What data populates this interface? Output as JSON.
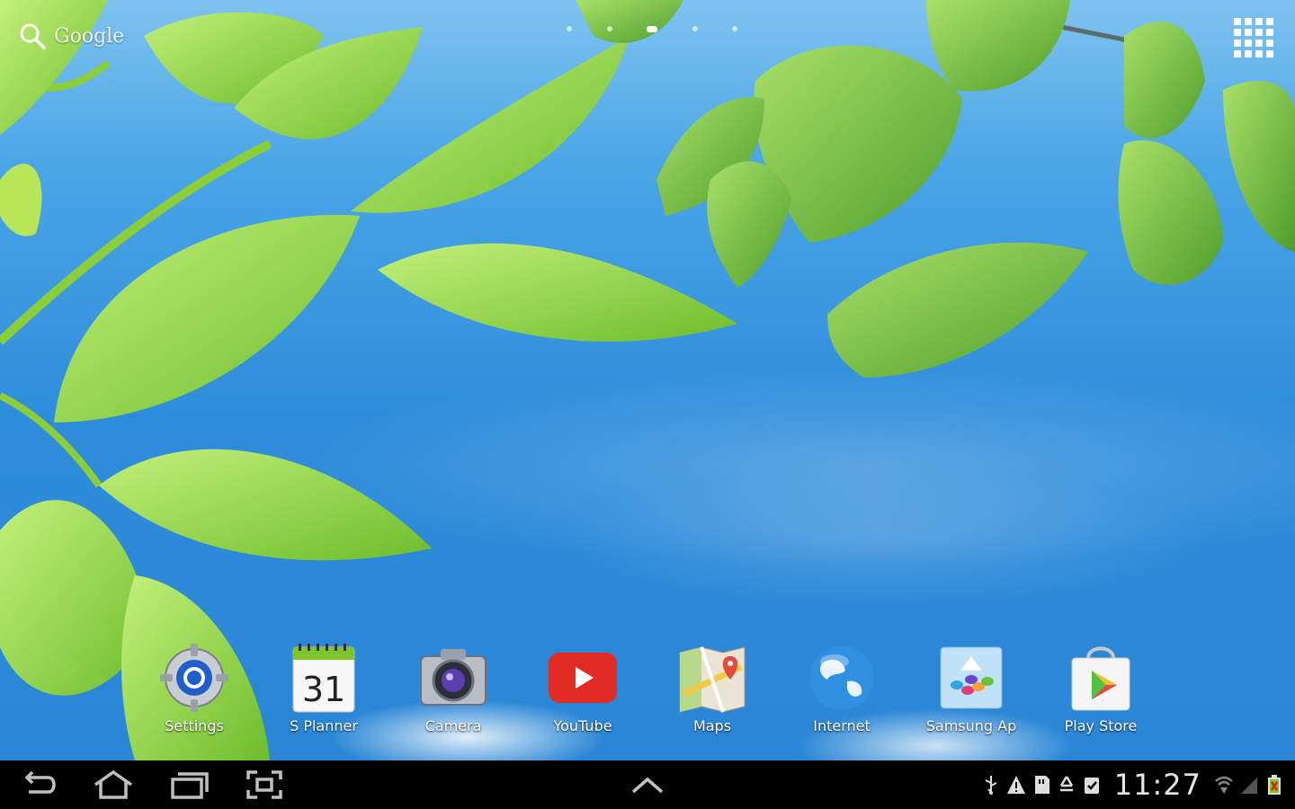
{
  "search": {
    "label": "Google",
    "icon": "search-icon"
  },
  "home_pages": {
    "count": 5,
    "active_index": 2
  },
  "apps_button": {
    "icon": "apps-grid-icon"
  },
  "dock": {
    "apps": [
      {
        "label": "Settings",
        "icon": "settings-icon"
      },
      {
        "label": "S Planner",
        "icon": "calendar-icon",
        "day": "31"
      },
      {
        "label": "Camera",
        "icon": "camera-icon"
      },
      {
        "label": "YouTube",
        "icon": "youtube-icon"
      },
      {
        "label": "Maps",
        "icon": "maps-icon"
      },
      {
        "label": "Internet",
        "icon": "globe-icon"
      },
      {
        "label": "Samsung Ap",
        "icon": "samsung-apps-icon"
      },
      {
        "label": "Play Store",
        "icon": "play-store-icon"
      }
    ]
  },
  "navbar": {
    "buttons": [
      "back-icon",
      "home-icon",
      "recent-apps-icon",
      "screenshot-icon",
      "chevron-up-icon"
    ],
    "status_icons": [
      "usb-icon",
      "warning-icon",
      "sd-card-icon",
      "recycle-icon",
      "clipboard-check-icon"
    ],
    "time": "11:27",
    "system_icons": [
      "wifi-icon",
      "signal-icon",
      "battery-icon"
    ]
  },
  "colors": {
    "sky": "#2b87d4",
    "leaf_light": "#9be04a",
    "leaf_dark": "#6db33a",
    "navbar": "#000000"
  }
}
